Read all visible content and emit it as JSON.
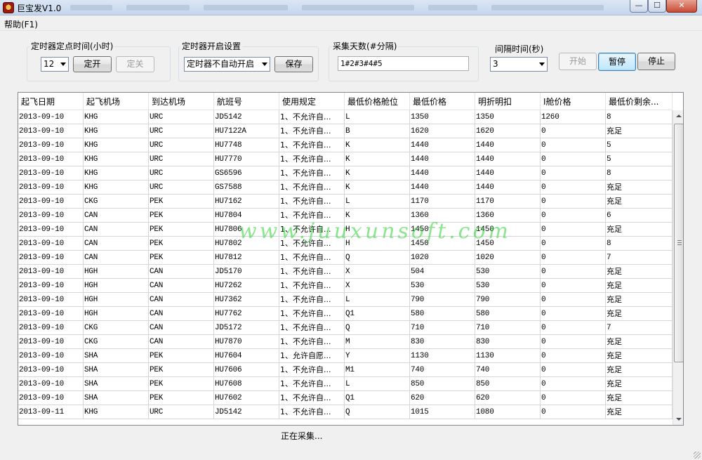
{
  "window": {
    "title": "巨宝发V1.0",
    "minimize_glyph": "—",
    "maximize_glyph": "☐",
    "close_glyph": "✕"
  },
  "menu": {
    "help": "帮助(F1)"
  },
  "timer_fixed": {
    "label": "定时器定点时间(小时)",
    "hour_value": "12",
    "on_button": "定开",
    "off_button": "定关"
  },
  "timer_start": {
    "label": "定时器开启设置",
    "mode_value": "定时器不自动开启",
    "save_button": "保存"
  },
  "collect_days": {
    "label": "采集天数(#分隔)",
    "value": "1#2#3#4#5"
  },
  "interval": {
    "label": "间隔时间(秒)",
    "value": "3"
  },
  "controls": {
    "start": "开始",
    "pause": "暂停",
    "stop": "停止"
  },
  "grid": {
    "columns": [
      "起飞日期",
      "起飞机场",
      "到达机场",
      "航班号",
      "使用规定",
      "最低价格舱位",
      "最低价格",
      "明折明扣",
      "I舱价格",
      "最低价剩余..."
    ],
    "rows": [
      [
        "2013-09-10",
        "KHG",
        "URC",
        "JD5142",
        "1、不允许自...",
        "L",
        "1350",
        "1350",
        "1260",
        "8"
      ],
      [
        "2013-09-10",
        "KHG",
        "URC",
        "HU7122A",
        "1、不允许自...",
        "B",
        "1620",
        "1620",
        "0",
        "充足"
      ],
      [
        "2013-09-10",
        "KHG",
        "URC",
        "HU7748",
        "1、不允许自...",
        "K",
        "1440",
        "1440",
        "0",
        "5"
      ],
      [
        "2013-09-10",
        "KHG",
        "URC",
        "HU7770",
        "1、不允许自...",
        "K",
        "1440",
        "1440",
        "0",
        "5"
      ],
      [
        "2013-09-10",
        "KHG",
        "URC",
        "GS6596",
        "1、不允许自...",
        "K",
        "1440",
        "1440",
        "0",
        "8"
      ],
      [
        "2013-09-10",
        "KHG",
        "URC",
        "GS7588",
        "1、不允许自...",
        "K",
        "1440",
        "1440",
        "0",
        "充足"
      ],
      [
        "2013-09-10",
        "CKG",
        "PEK",
        "HU7162",
        "1、不允许自...",
        "L",
        "1170",
        "1170",
        "0",
        "充足"
      ],
      [
        "2013-09-10",
        "CAN",
        "PEK",
        "HU7804",
        "1、不允许自...",
        "K",
        "1360",
        "1360",
        "0",
        "6"
      ],
      [
        "2013-09-10",
        "CAN",
        "PEK",
        "HU7806",
        "1、不允许自...",
        "H",
        "1450",
        "1450",
        "0",
        "充足"
      ],
      [
        "2013-09-10",
        "CAN",
        "PEK",
        "HU7802",
        "1、不允许自...",
        "H",
        "1450",
        "1450",
        "0",
        "8"
      ],
      [
        "2013-09-10",
        "CAN",
        "PEK",
        "HU7812",
        "1、不允许自...",
        "Q",
        "1020",
        "1020",
        "0",
        "7"
      ],
      [
        "2013-09-10",
        "HGH",
        "CAN",
        "JD5170",
        "1、不允许自...",
        "X",
        "504",
        "530",
        "0",
        "充足"
      ],
      [
        "2013-09-10",
        "HGH",
        "CAN",
        "HU7262",
        "1、不允许自...",
        "X",
        "530",
        "530",
        "0",
        "充足"
      ],
      [
        "2013-09-10",
        "HGH",
        "CAN",
        "HU7362",
        "1、不允许自...",
        "L",
        "790",
        "790",
        "0",
        "充足"
      ],
      [
        "2013-09-10",
        "HGH",
        "CAN",
        "HU7762",
        "1、不允许自...",
        "Q1",
        "580",
        "580",
        "0",
        "充足"
      ],
      [
        "2013-09-10",
        "CKG",
        "CAN",
        "JD5172",
        "1、不允许自...",
        "Q",
        "710",
        "710",
        "0",
        "7"
      ],
      [
        "2013-09-10",
        "CKG",
        "CAN",
        "HU7870",
        "1、不允许自...",
        "M",
        "830",
        "830",
        "0",
        "充足"
      ],
      [
        "2013-09-10",
        "SHA",
        "PEK",
        "HU7604",
        "1、允许自愿...",
        "Y",
        "1130",
        "1130",
        "0",
        "充足"
      ],
      [
        "2013-09-10",
        "SHA",
        "PEK",
        "HU7606",
        "1、不允许自...",
        "M1",
        "740",
        "740",
        "0",
        "充足"
      ],
      [
        "2013-09-10",
        "SHA",
        "PEK",
        "HU7608",
        "1、不允许自...",
        "L",
        "850",
        "850",
        "0",
        "充足"
      ],
      [
        "2013-09-10",
        "SHA",
        "PEK",
        "HU7602",
        "1、不允许自...",
        "Q1",
        "620",
        "620",
        "0",
        "充足"
      ],
      [
        "2013-09-11",
        "KHG",
        "URC",
        "JD5142",
        "1、不允许自...",
        "Q",
        "1015",
        "1080",
        "0",
        "充足"
      ]
    ]
  },
  "watermark": "www.juuxunsoft.com",
  "status": "正在采集..."
}
